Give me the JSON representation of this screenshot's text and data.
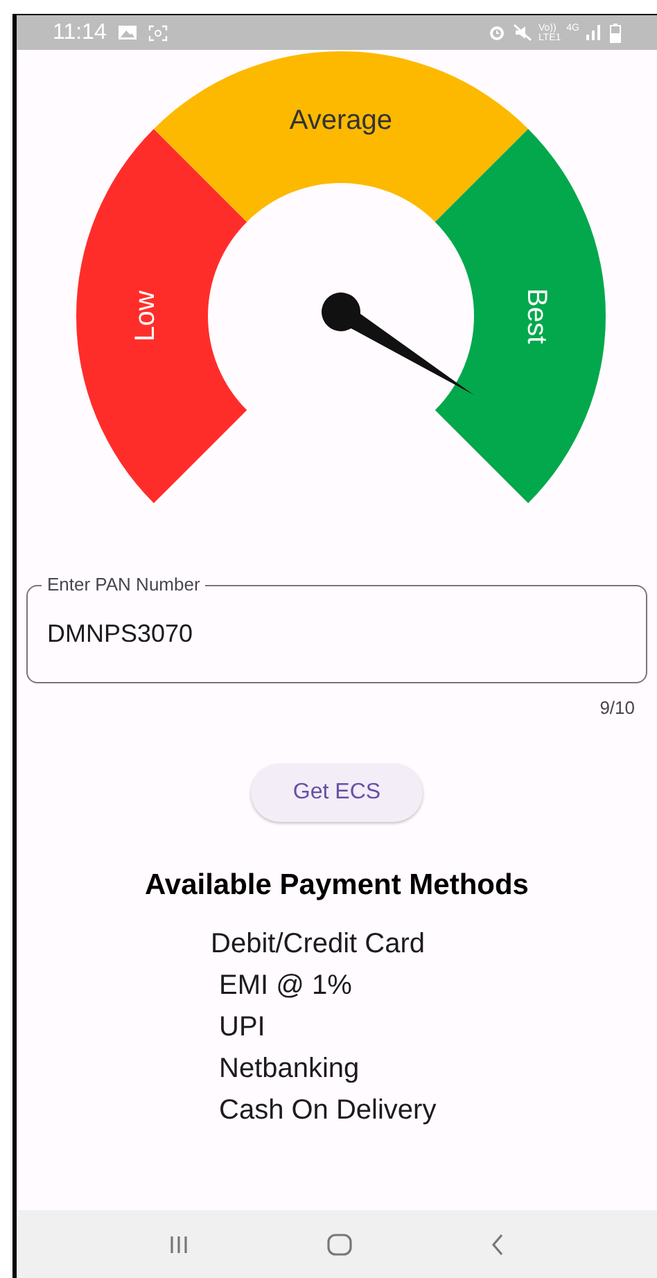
{
  "status_bar": {
    "time": "11:14",
    "network_labels": [
      "Vo))",
      "LTE1",
      "4G"
    ]
  },
  "gauge": {
    "segments": [
      {
        "label": "Low",
        "color": "#ff2d2a"
      },
      {
        "label": "Average",
        "color": "#fdb900"
      },
      {
        "label": "Best",
        "color": "#02a84b"
      }
    ]
  },
  "pan_field": {
    "label": "Enter PAN Number",
    "value": "DMNPS3070",
    "counter": "9/10"
  },
  "get_ecs_button": "Get ECS",
  "payment_methods": {
    "title": "Available Payment Methods",
    "items": [
      "Debit/Credit Card",
      "EMI @ 1%",
      "UPI",
      "Netbanking",
      "Cash On Delivery"
    ]
  }
}
